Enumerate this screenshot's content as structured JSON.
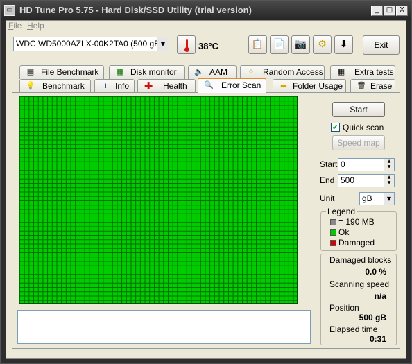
{
  "window": {
    "title": "HD Tune Pro 5.75 - Hard Disk/SSD Utility (trial version)",
    "controls": {
      "minimize": "_",
      "maximize": "□",
      "close": "X"
    }
  },
  "menu": [
    "File",
    "Help"
  ],
  "toolbar": {
    "drive": "WDC WD5000AZLX-00K2TA0 (500 gB)",
    "temperature": "38°C",
    "exit_label": "Exit",
    "icons": [
      "copy-info-icon",
      "copy-text-icon",
      "screenshot-icon",
      "options-icon",
      "save-icon"
    ]
  },
  "tabs_top": [
    {
      "label": "File Benchmark",
      "icon": "file-benchmark-icon"
    },
    {
      "label": "Disk monitor",
      "icon": "disk-monitor-icon"
    },
    {
      "label": "AAM",
      "icon": "speaker-icon"
    },
    {
      "label": "Random Access",
      "icon": "random-access-icon"
    },
    {
      "label": "Extra tests",
      "icon": "extra-tests-icon"
    }
  ],
  "tabs_bottom": [
    {
      "label": "Benchmark",
      "icon": "lightbulb-icon"
    },
    {
      "label": "Info",
      "icon": "info-icon"
    },
    {
      "label": "Health",
      "icon": "health-cross-icon"
    },
    {
      "label": "Error Scan",
      "icon": "magnifier-icon",
      "active": true
    },
    {
      "label": "Folder Usage",
      "icon": "folder-icon"
    },
    {
      "label": "Erase",
      "icon": "trash-icon"
    }
  ],
  "scan": {
    "start_button": "Start",
    "quick_scan_label": "Quick scan",
    "quick_scan_checked": true,
    "speed_map_button": "Speed map",
    "start_label": "Start",
    "start_value": "0",
    "end_label": "End",
    "end_value": "500",
    "unit_label": "Unit",
    "unit_value": "gB",
    "block_state": "ok",
    "log_text": ""
  },
  "legend": {
    "title": "Legend",
    "items": [
      {
        "label": "= 190 MB",
        "color": "#888888"
      },
      {
        "label": "Ok",
        "color": "#00cc00"
      },
      {
        "label": "Damaged",
        "color": "#dd0000"
      }
    ]
  },
  "stats": {
    "damaged_label": "Damaged blocks",
    "damaged_value": "0.0 %",
    "speed_label": "Scanning speed",
    "speed_value": "n/a",
    "position_label": "Position",
    "position_value": "500 gB",
    "elapsed_label": "Elapsed time",
    "elapsed_value": "0:31"
  }
}
